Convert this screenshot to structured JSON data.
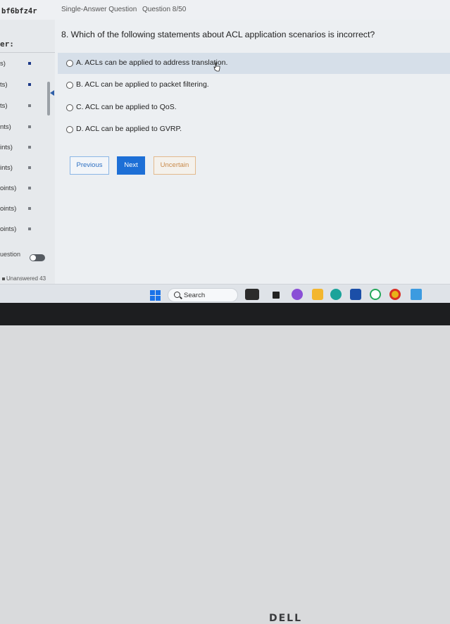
{
  "header": {
    "exam_id": "bf6bfz4r",
    "question_type": "Single-Answer Question",
    "question_counter": "Question 8/50"
  },
  "sidebar": {
    "heading": "er:",
    "sections": [
      {
        "label": "s)"
      },
      {
        "label": "ts)"
      },
      {
        "label": "ts)"
      },
      {
        "label": "nts)"
      },
      {
        "label": "ints)"
      },
      {
        "label": "ints)"
      },
      {
        "label": "oints)"
      },
      {
        "label": "oints)"
      },
      {
        "label": "oints)"
      }
    ],
    "toggle_label": "uestion",
    "unanswered": "Unanswered 43"
  },
  "question": {
    "text": "8. Which of the following statements about ACL application scenarios is incorrect?",
    "options": [
      {
        "label": "A. ACLs can be applied to address translation."
      },
      {
        "label": "B. ACL can be applied to packet filtering."
      },
      {
        "label": "C. ACL can be applied to QoS."
      },
      {
        "label": "D. ACL can be applied to GVRP."
      }
    ]
  },
  "buttons": {
    "previous": "Previous",
    "next": "Next",
    "uncertain": "Uncertain"
  },
  "taskbar": {
    "search_label": "Search",
    "icons": [
      "windows-start-icon",
      "search-icon",
      "weather-icon",
      "task-view-icon",
      "copilot-icon",
      "file-explorer-icon",
      "edge-icon",
      "store-icon",
      "whatsapp-icon",
      "chrome-icon",
      "app-icon"
    ]
  },
  "colors": {
    "accent": "#1d6fd6",
    "highlight_row": "#d6dfe9",
    "uncertain": "#c98a4a"
  },
  "device": {
    "brand": "DELL"
  }
}
